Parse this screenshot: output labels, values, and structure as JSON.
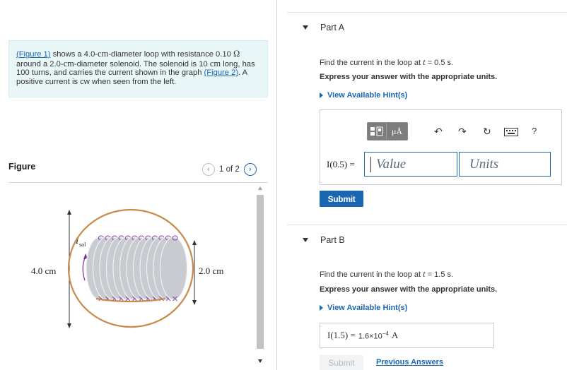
{
  "problem": {
    "figure1_link": "(Figure 1)",
    "text_a": " shows a 4.0-",
    "cm": "cm",
    "text_b": "-diameter loop with resistance 0.10 ",
    "ohm": "Ω",
    "text_c": " around a 2.0-",
    "text_d": "-diameter solenoid. The solenoid is 10 ",
    "text_e": " long, has 100 turns, and carries the current shown in the graph ",
    "figure2_link": "(Figure 2)",
    "text_f": ". A positive current is cw when seen from the left."
  },
  "figure": {
    "label": "Figure",
    "pager": "1 of 2",
    "prev_symbol": "‹",
    "next_symbol": "›",
    "loop_diameter": "4.0 cm",
    "solenoid_diameter": "2.0 cm",
    "current_label": "I",
    "current_sub": "sol"
  },
  "part_a": {
    "title": "Part A",
    "question_prefix": "Find the current in the loop at ",
    "t": "t",
    "question_suffix": " = 0.5 s.",
    "instruction": "Express your answer with the appropriate units.",
    "hint": "View Available Hint(s)",
    "input_label": "I(0.5) =",
    "value_placeholder": "Value",
    "units_placeholder": "Units",
    "submit": "Submit",
    "toolbar": {
      "template_icon": "fraction-template-icon",
      "units_button": "μÅ",
      "help": "?"
    }
  },
  "part_b": {
    "title": "Part B",
    "question_prefix": "Find the current in the loop at ",
    "t": "t",
    "question_suffix": " = 1.5 s.",
    "instruction": "Express your answer with the appropriate units.",
    "hint": "View Available Hint(s)",
    "answer_label": "I(1.5) =",
    "answer_mantissa": "1.6×10",
    "answer_exponent": "−4",
    "answer_unit": "A",
    "submit": "Submit",
    "previous_answers": "Previous Answers"
  },
  "colors": {
    "accent": "#1a66b3",
    "problem_bg": "#e9f6f7",
    "loop": "#c98a4b",
    "coil": "#c8cbd0",
    "wire": "#8e44ad"
  }
}
